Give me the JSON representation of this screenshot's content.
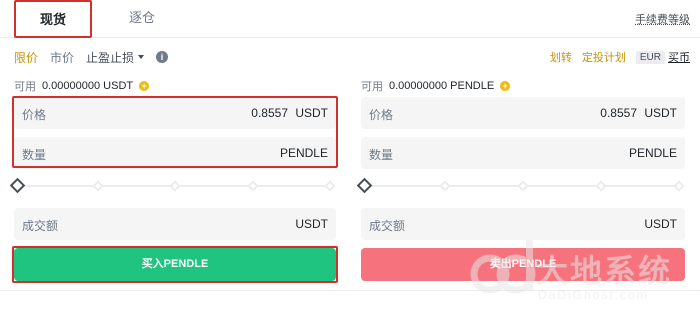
{
  "tabs": {
    "spot": "现货",
    "margin": "逐仓"
  },
  "fee_link": "手续费等级",
  "order_types": {
    "limit": "限价",
    "market": "市价",
    "stop": "止盈止损"
  },
  "right_links": {
    "transfer": "划转",
    "plan": "定投计划",
    "currency_badge": "EUR",
    "buy_coin": "买币"
  },
  "buy": {
    "available_label": "可用",
    "available_value": "0.00000000 USDT",
    "price_label": "价格",
    "price_value": "0.8557",
    "price_unit": "USDT",
    "amount_label": "数量",
    "amount_unit": "PENDLE",
    "total_label": "成交额",
    "total_unit": "USDT",
    "slider_percent": 0,
    "button": "买入PENDLE"
  },
  "sell": {
    "available_label": "可用",
    "available_value": "0.00000000 PENDLE",
    "price_label": "价格",
    "price_value": "0.8557",
    "price_unit": "USDT",
    "amount_label": "数量",
    "amount_unit": "PENDLE",
    "total_label": "成交额",
    "total_unit": "USDT",
    "slider_percent": 0,
    "button": "卖出PENDLE"
  },
  "watermark": {
    "text": "大地系统",
    "sub": "DaDiGhost.com"
  },
  "colors": {
    "accent": "#c99400",
    "buy": "#1ec47f",
    "sell": "#f6727d",
    "highlight": "#d0312d"
  }
}
